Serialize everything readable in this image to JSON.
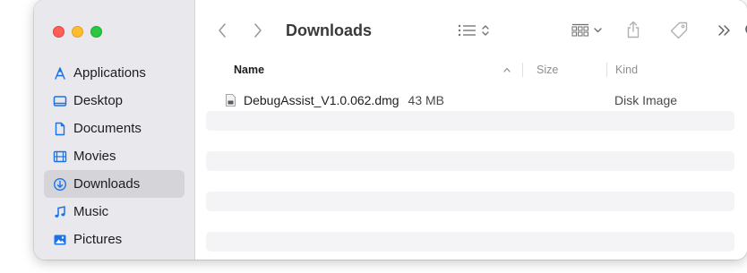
{
  "window": {
    "title": "Downloads"
  },
  "sidebar": {
    "items": [
      {
        "label": "Applications",
        "icon": "applications-icon"
      },
      {
        "label": "Desktop",
        "icon": "desktop-icon"
      },
      {
        "label": "Documents",
        "icon": "document-icon"
      },
      {
        "label": "Movies",
        "icon": "film-icon"
      },
      {
        "label": "Downloads",
        "icon": "download-icon",
        "selected": true
      },
      {
        "label": "Music",
        "icon": "music-note-icon"
      },
      {
        "label": "Pictures",
        "icon": "photo-icon"
      }
    ]
  },
  "toolbar": {
    "back": "back-chevron-icon",
    "forward": "forward-chevron-icon",
    "view": "list-view-icon",
    "group": "group-grid-icon",
    "share": "share-icon",
    "tag": "tag-icon",
    "more": "more-chevrons-icon",
    "search": "search-icon"
  },
  "columns": {
    "name": "Name",
    "size": "Size",
    "kind": "Kind"
  },
  "files": [
    {
      "name": "DebugAssist_V1.0.062.dmg",
      "size": "43 MB",
      "kind": "Disk Image",
      "icon": "disk-image-icon"
    }
  ],
  "colors": {
    "accent_selected_sidebar": "#d5d4d9",
    "sidebar_icon": "#1a73e8",
    "close": "#fe5f57",
    "minimize": "#febc2e",
    "maximize": "#28c840"
  }
}
